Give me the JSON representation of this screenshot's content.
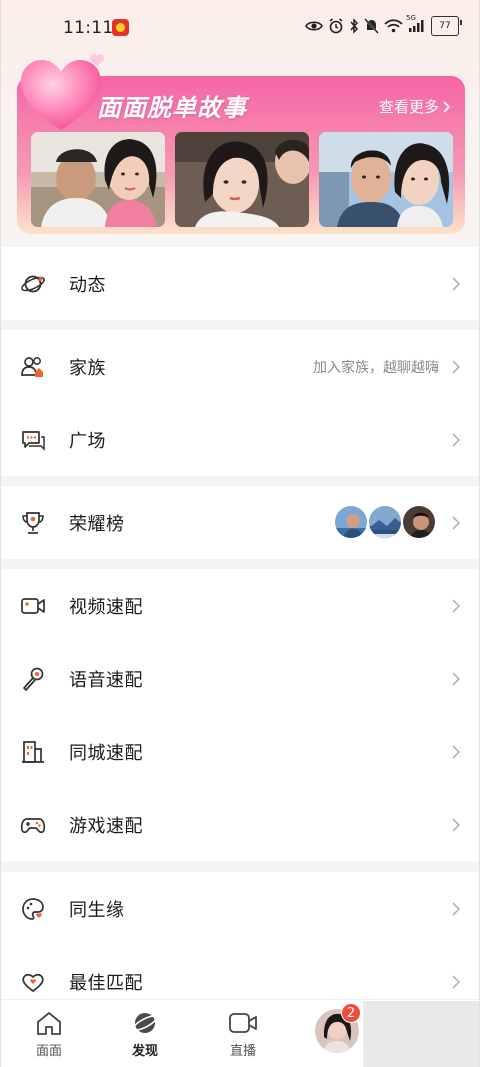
{
  "status_bar": {
    "time": "11:11",
    "battery": "77",
    "network": "5G"
  },
  "banner": {
    "title": "面面脱单故事",
    "more_label": "查看更多",
    "photo_count": 3
  },
  "groups": [
    {
      "items": [
        {
          "label": "动态",
          "icon": "planet-icon"
        }
      ]
    },
    {
      "items": [
        {
          "label": "家族",
          "icon": "family-icon",
          "hint": "加入家族，越聊越嗨"
        },
        {
          "label": "广场",
          "icon": "chat-bubble-icon"
        }
      ]
    },
    {
      "items": [
        {
          "label": "荣耀榜",
          "icon": "trophy-icon"
        }
      ]
    },
    {
      "items": [
        {
          "label": "视频速配",
          "icon": "video-camera-icon"
        },
        {
          "label": "语音速配",
          "icon": "microphone-icon"
        },
        {
          "label": "同城速配",
          "icon": "building-icon"
        },
        {
          "label": "游戏速配",
          "icon": "gamepad-icon"
        }
      ]
    },
    {
      "items": [
        {
          "label": "同生缘",
          "icon": "palette-heart-icon"
        },
        {
          "label": "最佳匹配",
          "icon": "match-heart-icon"
        }
      ]
    }
  ],
  "tabbar": {
    "tabs": [
      {
        "label": "面面",
        "icon": "home-icon"
      },
      {
        "label": "发现",
        "icon": "planet-icon",
        "active": true
      },
      {
        "label": "直播",
        "icon": "live-camera-icon"
      }
    ],
    "me_badge": "2"
  },
  "colors": {
    "accent_pink": "#f565a5",
    "badge_red": "#f14b3b",
    "icon_orange": "#f0662e"
  }
}
